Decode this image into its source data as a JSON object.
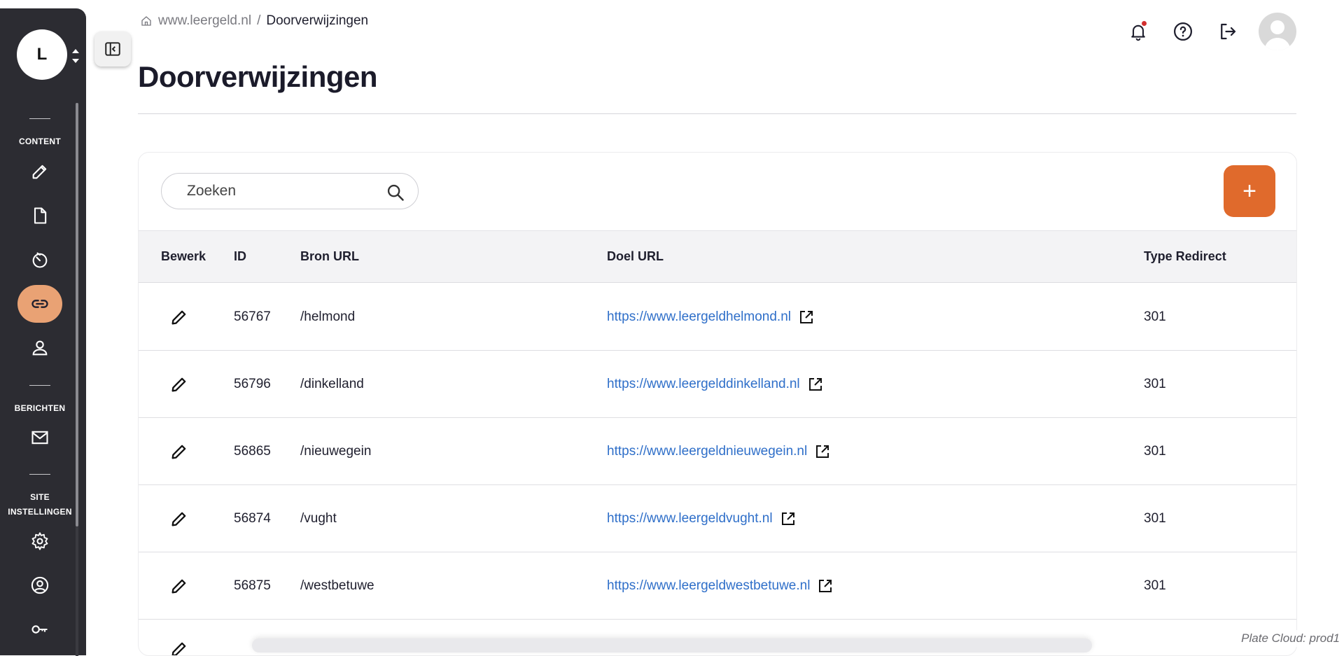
{
  "sidebar": {
    "avatar_initial": "L",
    "sections": [
      {
        "label": "CONTENT"
      },
      {
        "label": "BERICHTEN"
      },
      {
        "label": "SITE INSTELLINGEN"
      }
    ],
    "icons": [
      "edit-icon",
      "document-icon",
      "dashboard-icon",
      "link-icon",
      "user-icon",
      "mail-icon",
      "settings-icon",
      "account-circle-icon",
      "key-icon"
    ],
    "active_item": "link-icon",
    "active_color": "#e9a274",
    "background": "#2c2c32"
  },
  "breadcrumb": {
    "home": "www.leergeld.nl",
    "separator": "/",
    "current": "Doorverwijzingen"
  },
  "page": {
    "title": "Doorverwijzingen"
  },
  "header_icons": [
    "notification-bell-icon",
    "help-icon",
    "logout-icon",
    "user-avatar"
  ],
  "search": {
    "placeholder": "Zoeken",
    "value": ""
  },
  "add_button": {
    "label": "+",
    "color": "#e06a2c"
  },
  "table": {
    "columns": [
      "Bewerk",
      "ID",
      "Bron URL",
      "Doel URL",
      "Type Redirect"
    ],
    "rows": [
      {
        "id": "56767",
        "bron": "/helmond",
        "doel": "https://www.leergeldhelmond.nl",
        "type": "301"
      },
      {
        "id": "56796",
        "bron": "/dinkelland",
        "doel": "https://www.leergelddinkelland.nl",
        "type": "301"
      },
      {
        "id": "56865",
        "bron": "/nieuwegein",
        "doel": "https://www.leergeldnieuwegein.nl",
        "type": "301"
      },
      {
        "id": "56874",
        "bron": "/vught",
        "doel": "https://www.leergeldvught.nl",
        "type": "301"
      },
      {
        "id": "56875",
        "bron": "/westbetuwe",
        "doel": "https://www.leergeldwestbetuwe.nl",
        "type": "301"
      }
    ],
    "link_color": "#2f6fc9"
  },
  "footer": {
    "env_label": "Plate Cloud: prod1"
  }
}
